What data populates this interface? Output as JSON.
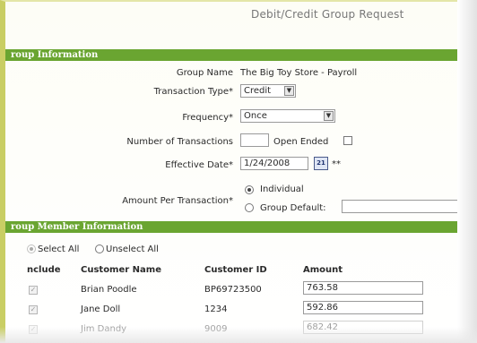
{
  "page": {
    "title": "Debit/Credit Group Request"
  },
  "sections": {
    "group_info": "roup Information",
    "group_member": "roup Member Information"
  },
  "form": {
    "group_name_label": "Group Name",
    "group_name_value": "The Big Toy Store - Payroll",
    "transaction_type_label": "Transaction Type*",
    "transaction_type_value": "Credit",
    "frequency_label": "Frequency*",
    "frequency_value": "Once",
    "num_transactions_label": "Number of Transactions",
    "num_transactions_value": "",
    "open_ended_label": "Open Ended",
    "effective_date_label": "Effective Date*",
    "effective_date_value": "1/24/2008",
    "calendar_day": "21",
    "date_marker": "**",
    "amount_label": "Amount Per Transaction*",
    "individual_label": "Individual",
    "group_default_label": "Group Default:",
    "group_default_value": ""
  },
  "members": {
    "select_all_label": "Select All",
    "unselect_all_label": "Unselect All",
    "columns": {
      "include": "nclude",
      "customer_name": "Customer Name",
      "customer_id": "Customer ID",
      "amount": "Amount"
    },
    "rows": [
      {
        "name": "Brian Poodle",
        "id": "BP69723500",
        "amount": "763.58"
      },
      {
        "name": "Jane Doll",
        "id": "1234",
        "amount": "592.86"
      },
      {
        "name": "Jim Dandy",
        "id": "9009",
        "amount": "682.42"
      }
    ]
  },
  "colors": {
    "section_green": "#6aa531",
    "frame_olive": "#c9ce64"
  }
}
